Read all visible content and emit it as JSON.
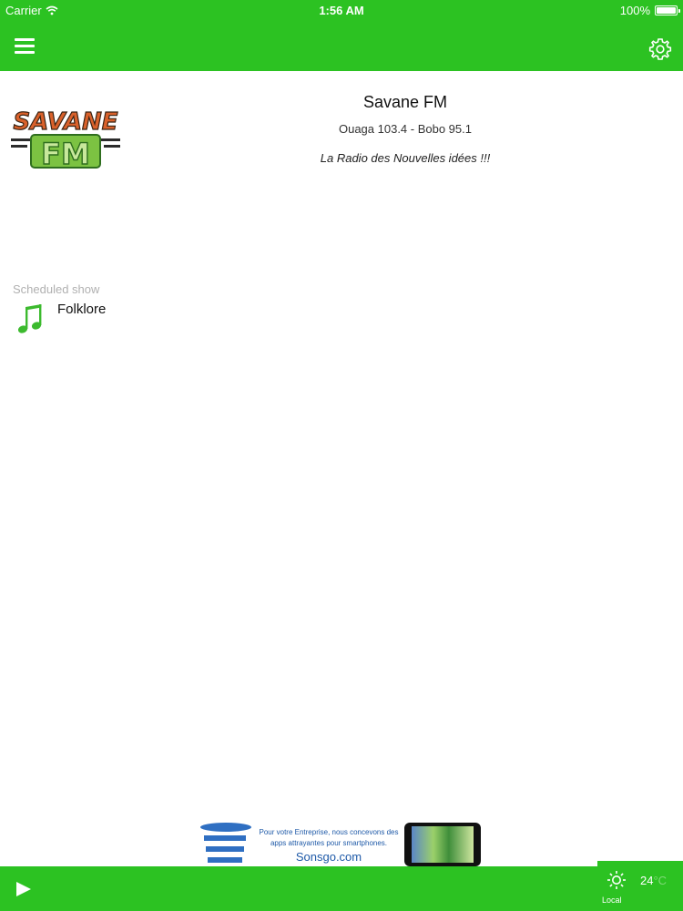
{
  "status_bar": {
    "carrier": "Carrier",
    "time": "1:56 AM",
    "battery": "100%"
  },
  "station": {
    "name": "Savane FM",
    "frequencies": "Ouaga 103.4 - Bobo 95.1",
    "slogan": "La Radio des Nouvelles idées !!!",
    "logo_text_top": "SAVANE",
    "logo_text_bottom": "FM"
  },
  "schedule": {
    "label": "Scheduled show",
    "show_title": "Folklore"
  },
  "ad": {
    "text": "Pour votre Entreprise, nous concevons des apps attrayantes pour smartphones.",
    "url": "Sonsgo.com"
  },
  "weather": {
    "temp": "24",
    "unit": "°C",
    "location": "Local"
  },
  "icons": {
    "menu": "menu-icon",
    "settings": "gear-icon",
    "play": "play-icon",
    "show": "music-note-icon",
    "weather": "sun-icon"
  },
  "colors": {
    "brand_green": "#2cc222",
    "ad_blue": "#1f5aa8",
    "label_gray": "#b0b0b0"
  }
}
